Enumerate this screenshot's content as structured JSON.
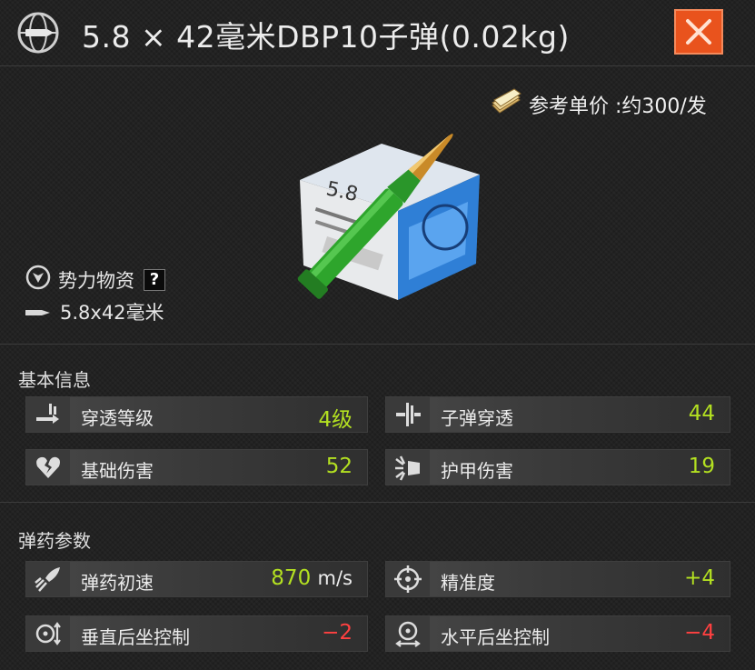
{
  "header": {
    "title": "5.8 × 42毫米DBP10子弹(0.02kg)",
    "icon": "bullet-globe-icon",
    "close_icon": "close-icon"
  },
  "price": {
    "label": "参考单价 :约300/发",
    "icon": "money-stack-icon"
  },
  "item": {
    "faction_label": "势力物资",
    "help_mark": "?",
    "caliber_label": "5.8x42毫米"
  },
  "sections": {
    "basic": {
      "title": "基本信息",
      "stats": [
        {
          "label": "穿透等级",
          "value": "4级",
          "icon": "penetration-level-icon"
        },
        {
          "label": "子弹穿透",
          "value": "44",
          "icon": "bullet-penetration-icon"
        },
        {
          "label": "基础伤害",
          "value": "52",
          "icon": "broken-heart-icon"
        },
        {
          "label": "护甲伤害",
          "value": "19",
          "icon": "armor-damage-icon"
        }
      ]
    },
    "ammo": {
      "title": "弹药参数",
      "stats": [
        {
          "label": "弹药初速",
          "value": "870",
          "unit": "m/s",
          "icon": "muzzle-velocity-icon"
        },
        {
          "label": "精准度",
          "value": "+4",
          "icon": "crosshair-icon"
        },
        {
          "label": "垂直后坐控制",
          "value": "−2",
          "icon": "vertical-recoil-icon"
        },
        {
          "label": "水平后坐控制",
          "value": "−4",
          "icon": "horizontal-recoil-icon"
        }
      ]
    }
  },
  "colors": {
    "positive": "#b3e021",
    "negative": "#ff4040",
    "close_button": "#e9531d"
  }
}
